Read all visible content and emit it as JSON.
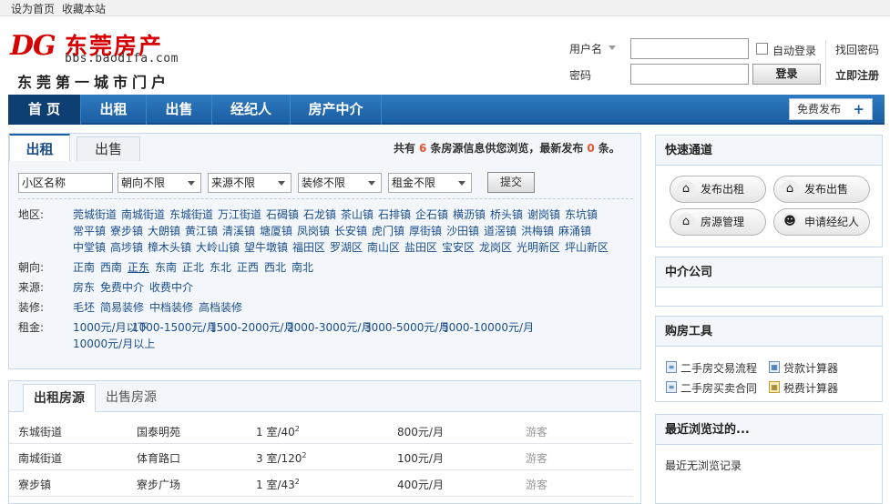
{
  "topbar": {
    "set_home": "设为首页",
    "bookmark": "收藏本站"
  },
  "logo": {
    "dg": "DG",
    "name": "东莞房产",
    "url": "bbs.baodifa.com",
    "slogan": "东莞第一城市门户"
  },
  "login": {
    "username_label": "用户名",
    "password_label": "密码",
    "auto_login": "自动登录",
    "login_button": "登录",
    "find_password": "找回密码",
    "register": "立即注册"
  },
  "nav": {
    "items": [
      "首 页",
      "出租",
      "出售",
      "经纪人",
      "房产中介"
    ],
    "publish": "免费发布",
    "publish_icon": "+"
  },
  "filter": {
    "tabs": [
      "出租",
      "出售"
    ],
    "summary_pre": "共有",
    "total": "6",
    "summary_mid": "条房源信息供您浏览，最新发布",
    "latest": "0",
    "summary_end": "条。",
    "community_placeholder": "小区名称",
    "orientation": "朝向不限",
    "source": "来源不限",
    "decoration": "装修不限",
    "rent": "租金不限",
    "submit": "提交",
    "labels": {
      "area": "地区:",
      "orientation": "朝向:",
      "source": "来源:",
      "decoration": "装修:",
      "rent": "租金:"
    },
    "areas": [
      [
        "莞城街道",
        "南城街道",
        "东城街道",
        "万江街道",
        "石碣镇",
        "石龙镇",
        "茶山镇",
        "石排镇",
        "企石镇",
        "横沥镇",
        "桥头镇",
        "谢岗镇",
        "东坑镇"
      ],
      [
        "常平镇",
        "寮步镇",
        "大朗镇",
        "黄江镇",
        "清溪镇",
        "塘厦镇",
        "凤岗镇",
        "长安镇",
        "虎门镇",
        "厚街镇",
        "沙田镇",
        "道滘镇",
        "洪梅镇",
        "麻涌镇"
      ],
      [
        "中堂镇",
        "高埗镇",
        "樟木头镇",
        "大岭山镇",
        "望牛墩镇",
        "福田区",
        "罗湖区",
        "南山区",
        "盐田区",
        "宝安区",
        "龙岗区",
        "光明新区",
        "坪山新区"
      ]
    ],
    "orientations": [
      "正南",
      "西南",
      "正东",
      "东南",
      "正北",
      "东北",
      "正西",
      "西北",
      "南北"
    ],
    "sources": [
      "房东",
      "免费中介",
      "收费中介"
    ],
    "decorations": [
      "毛坯",
      "简易装修",
      "中档装修",
      "高档装修"
    ],
    "rents": [
      "1000元/月以下",
      "1000-1500元/月",
      "1500-2000元/月",
      "2000-3000元/月",
      "3000-5000元/月",
      "5000-10000元/月",
      "10000元/月以上"
    ]
  },
  "listing": {
    "tabs": [
      "出租房源",
      "出售房源"
    ],
    "rows": [
      {
        "area": "东城街道",
        "community": "国泰明苑",
        "rooms": "1 室/40",
        "unit": "2",
        "price": "800元/月",
        "user": "游客"
      },
      {
        "area": "南城街道",
        "community": "体育路口",
        "rooms": "3 室/120",
        "unit": "2",
        "price": "100元/月",
        "user": "游客"
      },
      {
        "area": "寮步镇",
        "community": "寮步广场",
        "rooms": "1 室/43",
        "unit": "2",
        "price": "400元/月",
        "user": "游客"
      }
    ]
  },
  "sidebar": {
    "quick_title": "快速通道",
    "quick": [
      {
        "label": "发布出租",
        "icon": "house-icon"
      },
      {
        "label": "发布出售",
        "icon": "house-icon"
      },
      {
        "label": "房源管理",
        "icon": "house-icon"
      },
      {
        "label": "申请经纪人",
        "icon": "agent-icon"
      }
    ],
    "agency_title": "中介公司",
    "tools_title": "购房工具",
    "tools": [
      "二手房交易流程",
      "贷款计算器",
      "二手房买卖合同",
      "税费计算器"
    ],
    "recent_title": "最近浏览过的...",
    "recent_empty": "最近无浏览记录"
  }
}
